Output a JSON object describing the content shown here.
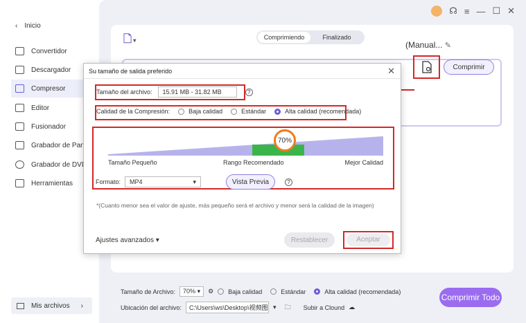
{
  "sidebar": {
    "back_label": "Inicio",
    "items": [
      {
        "label": "Convertidor",
        "icon": "convert-icon"
      },
      {
        "label": "Descargador",
        "icon": "download-icon"
      },
      {
        "label": "Compresor",
        "icon": "compress-icon",
        "active": true
      },
      {
        "label": "Editor",
        "icon": "scissors-icon"
      },
      {
        "label": "Fusionador",
        "icon": "merge-icon"
      },
      {
        "label": "Grabador de Pan.",
        "icon": "screen-record-icon"
      },
      {
        "label": "Grabador de DVD",
        "icon": "dvd-icon"
      },
      {
        "label": "Herramientas",
        "icon": "grid-icon"
      }
    ],
    "my_files_label": "Mis archivos"
  },
  "main": {
    "tabs": [
      "Comprimiendo",
      "Finalizado"
    ],
    "file_name": "(Manual...",
    "compress_button": "Comprimir",
    "bottom": {
      "file_size_label": "Tamaño de Archivo:",
      "file_size_value": "70%",
      "quality_options": [
        "Baja calidad",
        "Estándar",
        "Alta calidad (recomendada)"
      ],
      "location_label": "Ubicación del archivo:",
      "location_value": "C:\\Users\\ws\\Desktop\\视频图片",
      "cloud_upload": "Subir a Clound"
    },
    "compress_all_button": "Comprimir Todo"
  },
  "dialog": {
    "title": "Su tamaño de salida preferido",
    "file_size_label": "Tamaño del archivo:",
    "file_size_value": "15.91 MB - 31.82 MB",
    "quality_label": "Calidad de la Compresión:",
    "quality_options": [
      "Baja calidad",
      "Estándar",
      "Alta calidad (recomendada)"
    ],
    "selected_quality": "Alta calidad (recomendada)",
    "slider_value": "70%",
    "slider_fraction": 0.7,
    "slider_labels": [
      "Tamaño Pequeño",
      "Rango Recomendado",
      "Mejor Calidad"
    ],
    "format_label": "Formato:",
    "format_value": "MP4",
    "preview_button": "Vista Previa",
    "note": "*(Cuanto menor sea el valor de ajuste, más pequeño será el archivo y menor será la calidad de la imagen)",
    "advanced_label": "Ajustes avanzados",
    "reset_button": "Restablecer",
    "accept_button": "Aceptar"
  },
  "colors": {
    "accent": "#6b5bd6",
    "highlight_red": "#d42727",
    "slider_fill": "#b6b3ec",
    "slider_recommended": "#3bb54a",
    "slider_thumb": "#f07b1c"
  }
}
